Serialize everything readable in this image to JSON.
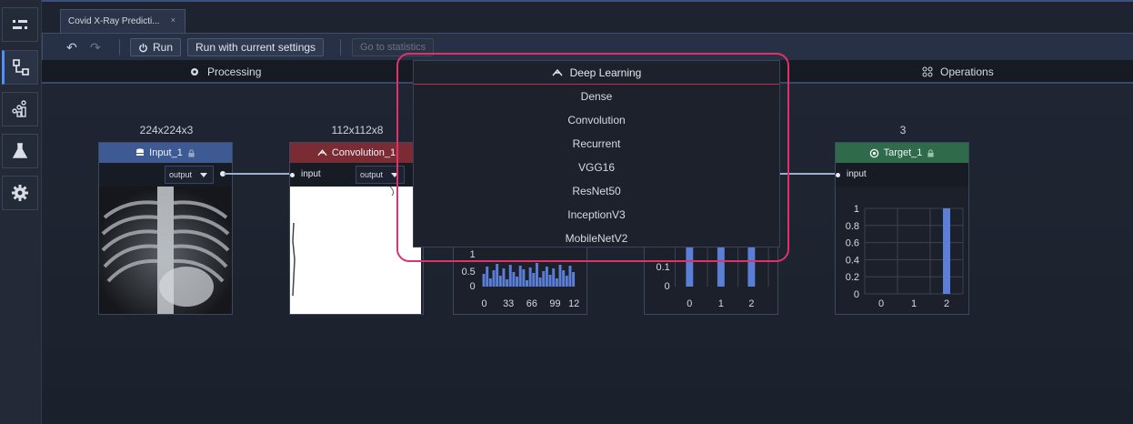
{
  "rail": {
    "items": [
      {
        "name": "model-list",
        "icon": "list-icon"
      },
      {
        "name": "modeling",
        "icon": "flow-icon",
        "active": true
      },
      {
        "name": "data",
        "icon": "dataset-icon"
      },
      {
        "name": "evaluation",
        "icon": "flask-icon"
      },
      {
        "name": "settings",
        "icon": "gear-icon"
      }
    ]
  },
  "tabs": [
    {
      "label": "Covid X-Ray Predicti...",
      "close": "×"
    }
  ],
  "toolbar": {
    "undo": "↶",
    "redo": "↷",
    "run_label": "Run",
    "run_current_label": "Run with current settings",
    "statistics_label": "Go to statistics"
  },
  "categories": {
    "processing": "Processing",
    "deep_learning": "Deep Learning",
    "operations": "Operations"
  },
  "dropdown": {
    "items": [
      "Dense",
      "Convolution",
      "Recurrent",
      "VGG16",
      "ResNet50",
      "InceptionV3",
      "MobileNetV2"
    ]
  },
  "nodes": {
    "input": {
      "dim": "224x224x3",
      "title": "Input_1",
      "output": "output",
      "color": "#3d5a94"
    },
    "conv": {
      "dim": "112x112x8",
      "title": "Convolution_1",
      "input": "input",
      "output": "output",
      "color": "#7a2b33"
    },
    "target": {
      "dim": "3",
      "title": "Target_1",
      "input": "input",
      "color": "#2f6a4b"
    }
  },
  "chart_data": [
    {
      "type": "bar",
      "title": "",
      "x_ticks": [
        "0",
        "33",
        "66",
        "99",
        "12"
      ],
      "y_ticks": [
        "0",
        "0.5",
        "1"
      ]
    },
    {
      "type": "bar",
      "categories": [
        "0",
        "1",
        "2"
      ],
      "y_ticks": [
        "0",
        "0.1"
      ],
      "values": [
        0.3,
        0.3,
        0.3
      ]
    },
    {
      "type": "bar",
      "categories": [
        "0",
        "1",
        "2"
      ],
      "values": [
        0,
        0,
        1
      ],
      "y_ticks": [
        "0",
        "0.2",
        "0.4",
        "0.6",
        "0.8",
        "1"
      ],
      "ylim": [
        0,
        1
      ]
    }
  ],
  "colors": {
    "accent": "#4f8ff7",
    "bar": "#5b7fd6",
    "highlight": "#e0326a"
  }
}
